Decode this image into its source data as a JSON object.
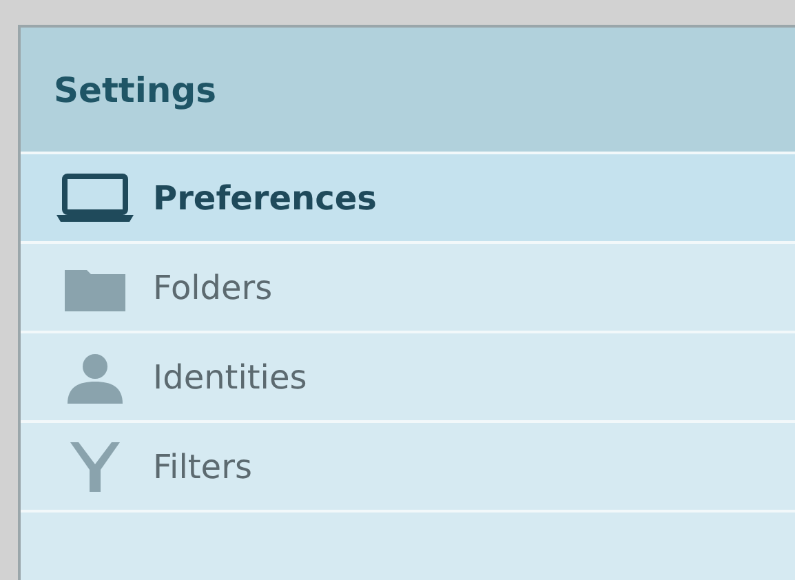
{
  "panel": {
    "title": "Settings"
  },
  "items": [
    {
      "label": "Preferences",
      "selected": true
    },
    {
      "label": "Folders",
      "selected": false
    },
    {
      "label": "Identities",
      "selected": false
    },
    {
      "label": "Filters",
      "selected": false
    }
  ]
}
